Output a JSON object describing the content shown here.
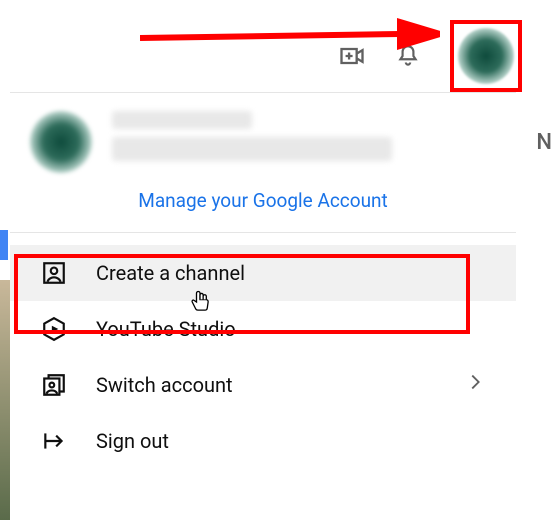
{
  "header": {
    "manage_link": "Manage your Google Account"
  },
  "menu": {
    "items": [
      {
        "label": "Create a channel",
        "icon": "person-box-icon",
        "has_chevron": false
      },
      {
        "label": "YouTube Studio",
        "icon": "hex-play-icon",
        "has_chevron": false
      },
      {
        "label": "Switch account",
        "icon": "switch-account-icon",
        "has_chevron": true
      },
      {
        "label": "Sign out",
        "icon": "signout-icon",
        "has_chevron": false
      }
    ]
  },
  "edge_right_char": "N",
  "annotation": {
    "highlight_color": "#ff0000"
  }
}
